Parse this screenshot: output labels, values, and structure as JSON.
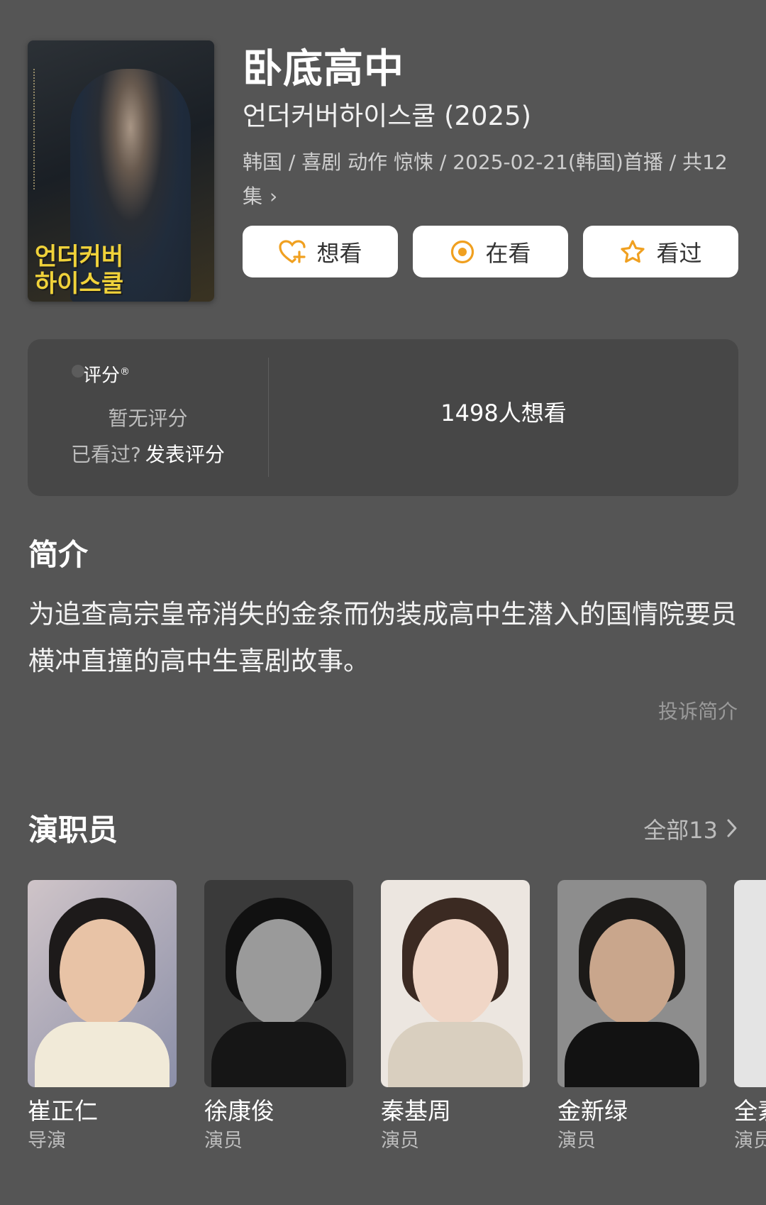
{
  "header": {
    "title": "卧底高中",
    "original_title": "언더커버하이스쿨 (2025)",
    "meta": "韩国 / 喜剧 动作 惊悚 / 2025-02-21(韩国)首播 / 共12集",
    "meta_chevron": "›",
    "poster_title": "언더커버 하이스쿨"
  },
  "actions": {
    "want": "想看",
    "watching": "在看",
    "watched": "看过",
    "accent_color": "#f0a020"
  },
  "rating": {
    "label": "评分",
    "mark": "®",
    "no_score": "暂无评分",
    "seen_question": "已看过?",
    "rate_link": "发表评分",
    "want_count": "1498人想看"
  },
  "intro": {
    "heading": "简介",
    "text": "为追查高宗皇帝消失的金条而伪装成高中生潜入的国情院要员横冲直撞的高中生喜剧故事。",
    "report": "投诉简介"
  },
  "cast": {
    "heading": "演职员",
    "all_label": "全部13",
    "members": [
      {
        "name": "崔正仁",
        "role": "导演"
      },
      {
        "name": "徐康俊",
        "role": "演员"
      },
      {
        "name": "秦基周",
        "role": "演员"
      },
      {
        "name": "金新绿",
        "role": "演员"
      },
      {
        "name": "全素",
        "role": "演员"
      }
    ]
  }
}
